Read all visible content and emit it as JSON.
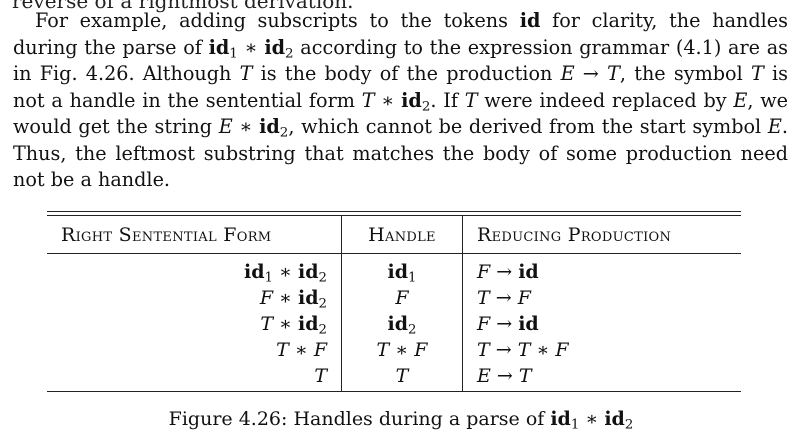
{
  "paragraph": {
    "top_cut": "reverse of a rightmost derivation.",
    "s1": "For example, adding subscripts to the tokens ",
    "s1_bold": "id",
    "s2": " for clarity, the handles during the parse of ",
    "s3": " according to the expression grammar (4.1) are as in Fig. 4.26. Although ",
    "s4": " is the body of the production ",
    "s5": ", the symbol ",
    "s6": " is not a handle in the sentential form ",
    "s7": ". If ",
    "s8": " were indeed replaced by ",
    "s9": ", we would get the string ",
    "s10": ", which cannot be derived from the start symbol ",
    "s11": ". Thus, the leftmost substring that matches the body of some production need not be a handle."
  },
  "symbols": {
    "id": "id",
    "sub1": "1",
    "sub2": "2",
    "star": " ∗ ",
    "T": "T",
    "E": "E",
    "F": "F",
    "arrow": " → ",
    "period_T": "T",
    "E_period": "E"
  },
  "table": {
    "headers": [
      "Right Sentential Form",
      "Handle",
      "Reducing Production"
    ],
    "rows": [
      {
        "form": "id1 ∗ id2",
        "handle": "id1",
        "production": "F → id"
      },
      {
        "form": "F ∗ id2",
        "handle": "F",
        "production": "T → F"
      },
      {
        "form": "T ∗ id2",
        "handle": "id2",
        "production": "F → id"
      },
      {
        "form": "T ∗ F",
        "handle": "T ∗ F",
        "production": "T → T ∗ F"
      },
      {
        "form": "T",
        "handle": "T",
        "production": "E → T"
      }
    ]
  },
  "caption": {
    "prefix": "Figure 4.26: Handles during a parse of ",
    "expr": "id1 ∗ id2"
  }
}
